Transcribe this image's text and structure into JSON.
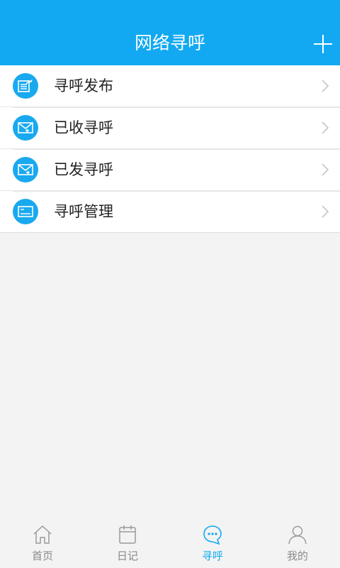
{
  "header": {
    "title": "网络寻呼",
    "add_icon": "plus-icon"
  },
  "menu": [
    {
      "label": "寻呼发布",
      "icon": "page-publish-icon"
    },
    {
      "label": "已收寻呼",
      "icon": "mail-inbox-icon"
    },
    {
      "label": "已发寻呼",
      "icon": "mail-sent-icon"
    },
    {
      "label": "寻呼管理",
      "icon": "screen-manage-icon"
    }
  ],
  "tabs": [
    {
      "label": "首页",
      "icon": "home-icon",
      "active": false
    },
    {
      "label": "日记",
      "icon": "calendar-icon",
      "active": false
    },
    {
      "label": "寻呼",
      "icon": "chat-bubble-icon",
      "active": true
    },
    {
      "label": "我的",
      "icon": "person-icon",
      "active": false
    }
  ],
  "colors": {
    "accent": "#12a9f2",
    "icon_bg": "#19a9ef",
    "background": "#f3f3f3"
  }
}
